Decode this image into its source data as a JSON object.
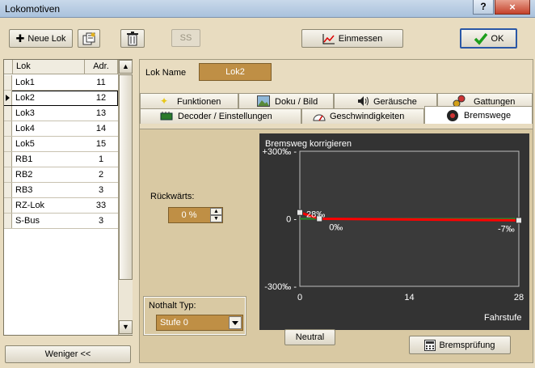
{
  "window": {
    "title": "Lokomotiven",
    "help_label": "?",
    "close_label": "×"
  },
  "toolbar": {
    "new_loco_label": "Neue Lok",
    "disabled_button_label": "SS",
    "calibrate_label": "Einmessen",
    "ok_label": "OK"
  },
  "loco_list": {
    "columns": [
      "Lok",
      "Adr."
    ],
    "rows": [
      {
        "name": "Lok1",
        "adr": "11"
      },
      {
        "name": "Lok2",
        "adr": "12"
      },
      {
        "name": "Lok3",
        "adr": "13"
      },
      {
        "name": "Lok4",
        "adr": "14"
      },
      {
        "name": "Lok5",
        "adr": "15"
      },
      {
        "name": "RB1",
        "adr": "1"
      },
      {
        "name": "RB2",
        "adr": "2"
      },
      {
        "name": "RB3",
        "adr": "3"
      },
      {
        "name": "RZ-Lok",
        "adr": "33"
      },
      {
        "name": "S-Bus",
        "adr": "3"
      }
    ],
    "selected": "Lok2",
    "fewer_label": "Weniger <<"
  },
  "loco_name": {
    "label": "Lok Name",
    "value": "Lok2"
  },
  "tabs": {
    "row1": [
      "Funktionen",
      "Doku / Bild",
      "Geräusche",
      "Gattungen"
    ],
    "row2": [
      "Decoder / Einstellungen",
      "Geschwindigkeiten",
      "Bremswege"
    ],
    "active": "Bremswege"
  },
  "brake": {
    "reverse_label": "Rückwärts:",
    "reverse_value": "0 %",
    "emergency_label": "Nothalt Typ:",
    "emergency_value": "Stufe 0",
    "neutral_label": "Neutral",
    "brake_test_label": "Bremsprüfung"
  },
  "chart_data": {
    "type": "line",
    "title": "Bremsweg korrigieren",
    "xlabel": "Fahrstufe",
    "ylabel": "",
    "x_ticks": [
      "0",
      "14",
      "28"
    ],
    "y_ticks": [
      "+300‰ -",
      "0 -",
      "-300‰ -"
    ],
    "xlim": [
      0,
      28
    ],
    "ylim": [
      -300,
      300
    ],
    "series": [
      {
        "x": [
          0,
          2.5,
          28
        ],
        "y": [
          28,
          0,
          -7
        ],
        "color": "#ff0000"
      }
    ],
    "reference_color": "#2a8a2a",
    "point_labels": [
      "28‰",
      "0‰",
      "-7‰"
    ]
  },
  "colors": {
    "accent": "#bf8f45",
    "chart_bg": "#333333",
    "panel": "#d9c9a3"
  }
}
